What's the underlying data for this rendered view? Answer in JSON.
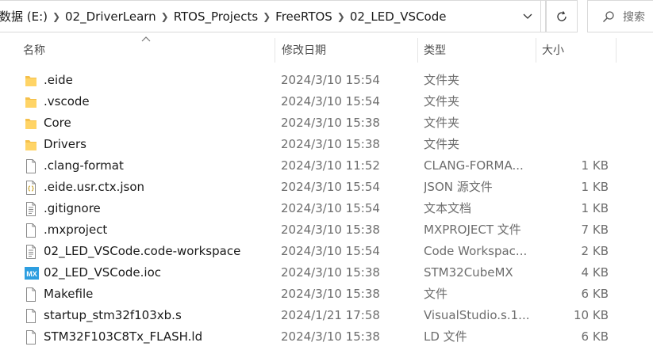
{
  "breadcrumb": [
    "数据 (E:)",
    "02_DriverLearn",
    "RTOS_Projects",
    "FreeRTOS",
    "02_LED_VSCode"
  ],
  "search": {
    "placeholder": "搜索"
  },
  "columns": {
    "name": "名称",
    "date": "修改日期",
    "type": "类型",
    "size": "大小"
  },
  "files": [
    {
      "name": ".eide",
      "date": "2024/3/10 15:54",
      "type": "文件夹",
      "size": "",
      "icon": "folder-icon"
    },
    {
      "name": ".vscode",
      "date": "2024/3/10 15:54",
      "type": "文件夹",
      "size": "",
      "icon": "folder-icon"
    },
    {
      "name": "Core",
      "date": "2024/3/10 15:38",
      "type": "文件夹",
      "size": "",
      "icon": "folder-icon"
    },
    {
      "name": "Drivers",
      "date": "2024/3/10 15:38",
      "type": "文件夹",
      "size": "",
      "icon": "folder-icon"
    },
    {
      "name": ".clang-format",
      "date": "2024/3/10 11:52",
      "type": "CLANG-FORMA...",
      "size": "1 KB",
      "icon": "file-icon"
    },
    {
      "name": ".eide.usr.ctx.json",
      "date": "2024/3/10 15:54",
      "type": "JSON 源文件",
      "size": "1 KB",
      "icon": "json-file-icon"
    },
    {
      "name": ".gitignore",
      "date": "2024/3/10 15:54",
      "type": "文本文档",
      "size": "1 KB",
      "icon": "text-file-icon"
    },
    {
      "name": ".mxproject",
      "date": "2024/3/10 15:38",
      "type": "MXPROJECT 文件",
      "size": "7 KB",
      "icon": "file-icon"
    },
    {
      "name": "02_LED_VSCode.code-workspace",
      "date": "2024/3/10 15:54",
      "type": "Code Workspac...",
      "size": "2 KB",
      "icon": "text-file-icon"
    },
    {
      "name": "02_LED_VSCode.ioc",
      "date": "2024/3/10 15:38",
      "type": "STM32CubeMX",
      "size": "4 KB",
      "icon": "stm32cubemx-icon",
      "icon_label": "MX"
    },
    {
      "name": "Makefile",
      "date": "2024/3/10 15:38",
      "type": "文件",
      "size": "6 KB",
      "icon": "file-icon"
    },
    {
      "name": "startup_stm32f103xb.s",
      "date": "2024/1/21 17:58",
      "type": "VisualStudio.s.1...",
      "size": "10 KB",
      "icon": "file-icon"
    },
    {
      "name": "STM32F103C8Tx_FLASH.ld",
      "date": "2024/3/10 15:38",
      "type": "LD 文件",
      "size": "6 KB",
      "icon": "file-icon"
    }
  ],
  "colors": {
    "folder": "#f5c04b",
    "mx_badge": "#2d9ee0",
    "border": "#d9d9d9"
  }
}
